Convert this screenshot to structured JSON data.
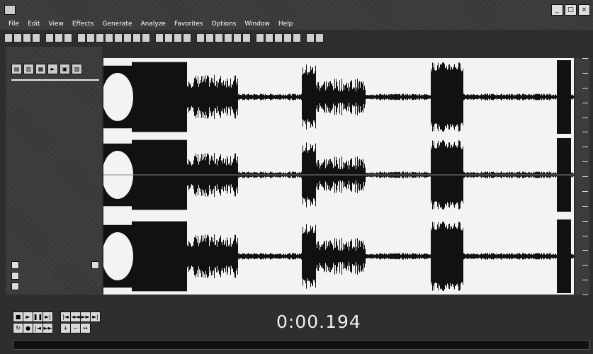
{
  "window": {
    "title": "",
    "controls": [
      "minimize-icon",
      "maximize-icon",
      "close-icon"
    ]
  },
  "menu": {
    "items": [
      "File",
      "Edit",
      "View",
      "Effects",
      "Generate",
      "Analyze",
      "Favorites",
      "Options",
      "Window",
      "Help"
    ]
  },
  "toolbar": {
    "groups": [
      4,
      3,
      8,
      4,
      6,
      5,
      2
    ]
  },
  "left_panel": {
    "title": "",
    "items": [
      {
        "label": "",
        "selected": true
      },
      {
        "label": "",
        "selected": false
      },
      {
        "label": "",
        "selected": false
      }
    ]
  },
  "waveform": {
    "colors": {
      "background": "#f3f3f3",
      "wave": "#111111"
    }
  },
  "transport": {
    "timecode": "0:00.194",
    "buttons_group1": [
      "stop",
      "play",
      "pause",
      "play-to-end",
      "loop",
      "record"
    ],
    "buttons_group2": [
      "go-to-start",
      "rewind",
      "fast-forward",
      "go-to-end",
      "zoom-in",
      "zoom-out"
    ]
  },
  "selection": {
    "lines": [
      "",
      "",
      ""
    ]
  }
}
